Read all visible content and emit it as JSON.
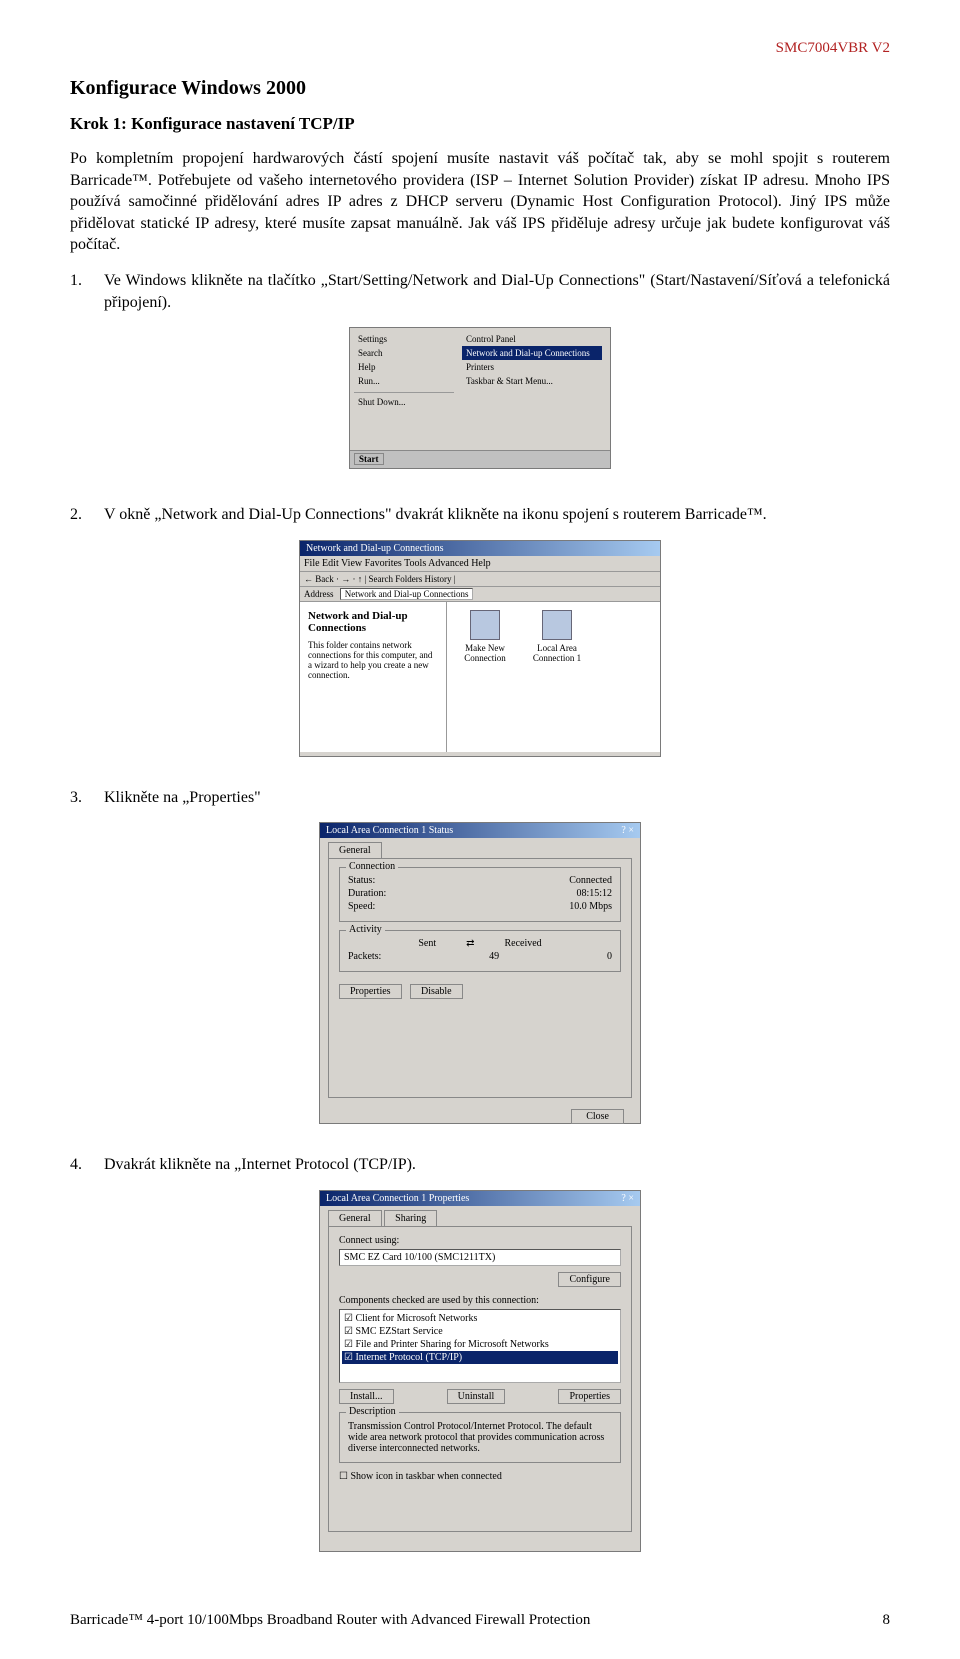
{
  "header": {
    "model": "SMC7004VBR V2"
  },
  "headings": {
    "h1": "Konfigurace Windows 2000",
    "h2": "Krok 1: Konfigurace nastavení TCP/IP"
  },
  "paragraphs": {
    "intro1": "Po kompletním propojení hardwarových částí spojení musíte nastavit váš počítač tak, aby se mohl spojit s routerem Barricade™. Potřebujete od vašeho internetového providera  (ISP – Internet Solution Provider) získat IP adresu.  Mnoho IPS  používá samočinné přidělování adres IP adres z DHCP serveru (Dynamic Host Configuration Protocol). Jiný IPS může přidělovat statické  IP adresy, které musíte zapsat manuálně. Jak váš IPS přiděluje adresy určuje jak budete konfigurovat váš počítač."
  },
  "steps": {
    "s1_num": "1.",
    "s1": "Ve Windows klikněte na tlačítko „Start/Setting/Network and Dial-Up Connections\" (Start/Nastavení/Síťová a telefonická připojení).",
    "s2_num": "2.",
    "s2": "V okně „Network and Dial-Up Connections\" dvakrát klikněte na ikonu spojení s routerem Barricade™.",
    "s3_num": "3.",
    "s3": "Klikněte na „Properties\"",
    "s4_num": "4.",
    "s4": "Dvakrát klikněte na „Internet Protocol (TCP/IP)."
  },
  "startmenu": {
    "left": [
      "Settings",
      "Search",
      "Help",
      "Run...",
      "Shut Down..."
    ],
    "right_top": "Control Panel",
    "right_hl": "Network and Dial-up Connections",
    "right": [
      "Printers",
      "Taskbar & Start Menu..."
    ],
    "start": "Start"
  },
  "netconn": {
    "title": "Network and Dial-up Connections",
    "menus": "File   Edit   View   Favorites   Tools   Advanced   Help",
    "toolbar": "← Back  ·  →  ·  ↑   | Search   Folders   History   |  ",
    "address_label": "Address",
    "address_value": "Network and Dial-up Connections",
    "pane_heading": "Network and Dial-up Connections",
    "pane_text": "This folder contains network connections for this computer, and a wizard to help you create a new connection.",
    "icon1": "Make New Connection",
    "icon2": "Local Area Connection 1"
  },
  "lacstatus": {
    "title": "Local Area Connection 1 Status",
    "winicons": "? ×",
    "tab": "General",
    "grp1": "Connection",
    "status_k": "Status:",
    "status_v": "Connected",
    "duration_k": "Duration:",
    "duration_v": "08:15:12",
    "speed_k": "Speed:",
    "speed_v": "10.0 Mbps",
    "grp2": "Activity",
    "sent": "Sent",
    "recv": "Received",
    "packets_k": "Packets:",
    "packets_sent": "49",
    "packets_recv": "0",
    "btn_props": "Properties",
    "btn_disable": "Disable",
    "btn_close": "Close"
  },
  "lacprops": {
    "title": "Local Area Connection 1 Properties",
    "winicons": "? ×",
    "tab1": "General",
    "tab2": "Sharing",
    "connect_using": "Connect using:",
    "adapter": "SMC EZ Card 10/100 (SMC1211TX)",
    "btn_configure": "Configure",
    "components_label": "Components checked are used by this connection:",
    "components": [
      "☑ Client for Microsoft Networks",
      "☑ SMC EZStart Service",
      "☑ File and Printer Sharing for Microsoft Networks",
      "☑ Internet Protocol (TCP/IP)"
    ],
    "btn_install": "Install...",
    "btn_uninstall": "Uninstall",
    "btn_props": "Properties",
    "grp_desc": "Description",
    "desc_text": "Transmission Control Protocol/Internet Protocol. The default wide area network protocol that provides communication across diverse interconnected networks.",
    "chk_taskbar": "☐ Show icon in taskbar when connected"
  },
  "footer": {
    "text": "Barricade™ 4-port 10/100Mbps Broadband Router with Advanced Firewall Protection",
    "page": "8"
  }
}
